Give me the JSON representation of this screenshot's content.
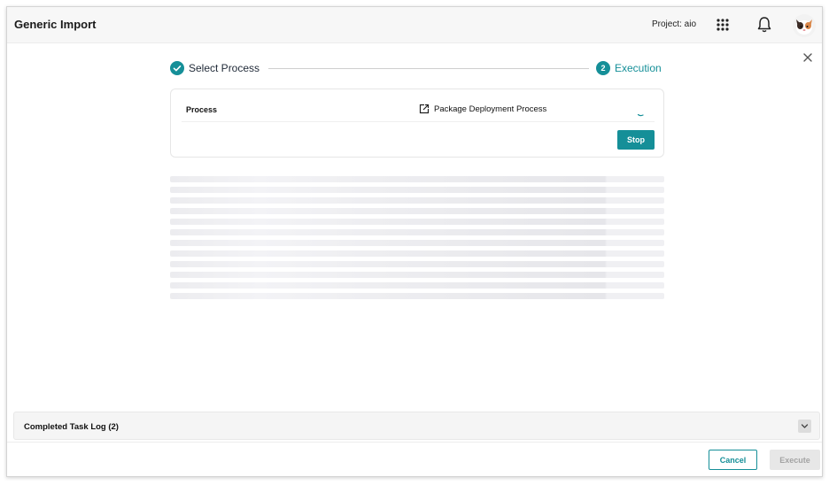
{
  "header": {
    "title": "Generic Import",
    "project": "Project: aio",
    "apps_icon": "apps-grid-icon",
    "bell_icon": "bell-icon",
    "avatar": "user-avatar"
  },
  "dialog": {
    "close_icon": "close-icon"
  },
  "stepper": {
    "steps": [
      {
        "label": "Select Process",
        "state": "completed",
        "icon": "check-circle-icon"
      },
      {
        "label": "Execution",
        "state": "active",
        "number": "2"
      }
    ],
    "accent_color": "#158f98"
  },
  "process_card": {
    "key": "Process",
    "value": "Package Deployment Process",
    "value_icon": "external-link-icon",
    "status_icon": "loading-spinner-icon",
    "stop_label": "Stop"
  },
  "task_log": {
    "title": "Completed Task Log (2)",
    "toggle_icon": "chevron-down-icon"
  },
  "footer": {
    "cancel_label": "Cancel",
    "execute_label": "Execute"
  }
}
